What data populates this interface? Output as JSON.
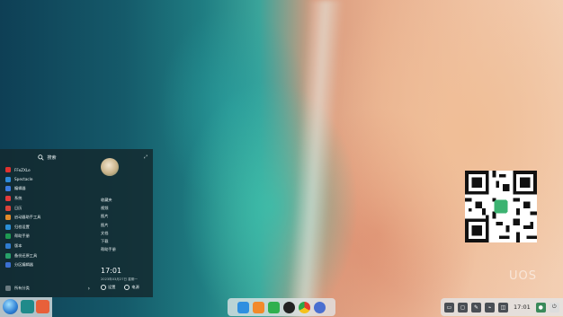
{
  "start_menu": {
    "search_placeholder": "搜索",
    "apps": [
      {
        "label": "FFeZXLe",
        "color": "#e0322f",
        "icon": "app-red-icon"
      },
      {
        "label": "Spectacle",
        "color": "#2d8ad8",
        "icon": "spectacle-icon"
      },
      {
        "label": "编辑器",
        "color": "#3b7be0",
        "icon": "editor-icon"
      },
      {
        "label": "系统",
        "color": "#e23b3b",
        "icon": "system-icon"
      },
      {
        "label": "日历",
        "color": "#d9443b",
        "icon": "calendar-icon"
      },
      {
        "label": "启动器助手工具",
        "color": "#e08a2a",
        "icon": "launcher-helper-icon"
      },
      {
        "label": "归档设置",
        "color": "#2a8fd6",
        "icon": "archive-settings-icon"
      },
      {
        "label": "帮助手册",
        "color": "#1e9a52",
        "icon": "help-manual-icon"
      },
      {
        "label": "版本",
        "color": "#2f7ccf",
        "icon": "version-icon"
      },
      {
        "label": "备份还原工具",
        "color": "#28a06a",
        "icon": "backup-restore-icon"
      },
      {
        "label": "分区编辑器",
        "color": "#3b6fd1",
        "icon": "partition-editor-icon"
      }
    ],
    "all_apps_label": "所有分类",
    "shortcuts": [
      "收藏夹",
      "视频",
      "图片",
      "图片",
      "文档",
      "下载",
      "帮助手册"
    ],
    "clock": "17:01",
    "date": "2023年03月27日 星期一",
    "power_labels": [
      "设置",
      "电源"
    ]
  },
  "desktop": {
    "watermark": "UOS"
  },
  "taskbar": {
    "tray_time": "17:01",
    "dock_icons": [
      "wifi-icon",
      "folder-icon",
      "store-icon",
      "music-icon",
      "chrome-icon",
      "settings-icon"
    ],
    "tray_icons": [
      "tray-icon",
      "tray-icon",
      "tray-icon",
      "tray-icon",
      "tray-icon"
    ]
  },
  "colors": {
    "menu_bg": "#14282d",
    "taskbar_bg": "#e1e6e8",
    "accent": "#2d7fd4"
  }
}
